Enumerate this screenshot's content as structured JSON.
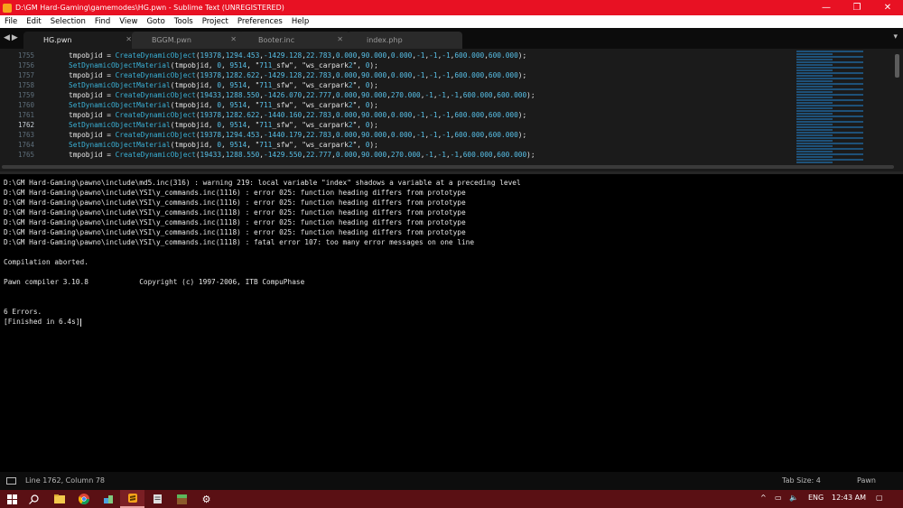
{
  "window": {
    "title": "D:\\GM Hard-Gaming\\gamemodes\\HG.pwn - Sublime Text (UNREGISTERED)",
    "minimize": "—",
    "maximize": "❐",
    "close": "✕"
  },
  "menu": [
    "File",
    "Edit",
    "Selection",
    "Find",
    "View",
    "Goto",
    "Tools",
    "Project",
    "Preferences",
    "Help"
  ],
  "tabs": [
    {
      "label": "HG.pwn",
      "active": true
    },
    {
      "label": "BGGM.pwn",
      "active": false
    },
    {
      "label": "Booter.inc",
      "active": false
    },
    {
      "label": "index.php",
      "active": false
    }
  ],
  "editor": {
    "line_numbers": [
      "1755",
      "1756",
      "1757",
      "1758",
      "1759",
      "1760",
      "1761",
      "1762",
      "1763",
      "1764",
      "1765"
    ],
    "current_line": "1762",
    "lines": [
      "tmpobjid = CreateDynamicObject(19378,1294.453,-1429.128,22.783,0.000,90.000,0.000,-1,-1,-1,600.000,600.000);",
      "SetDynamicObjectMaterial(tmpobjid, 0, 9514, \"711_sfw\", \"ws_carpark2\", 0);",
      "tmpobjid = CreateDynamicObject(19378,1282.622,-1429.128,22.783,0.000,90.000,0.000,-1,-1,-1,600.000,600.000);",
      "SetDynamicObjectMaterial(tmpobjid, 0, 9514, \"711_sfw\", \"ws_carpark2\", 0);",
      "tmpobjid = CreateDynamicObject(19433,1288.550,-1426.070,22.777,0.000,90.000,270.000,-1,-1,-1,600.000,600.000);",
      "SetDynamicObjectMaterial(tmpobjid, 0, 9514, \"711_sfw\", \"ws_carpark2\", 0);",
      "tmpobjid = CreateDynamicObject(19378,1282.622,-1440.160,22.783,0.000,90.000,0.000,-1,-1,-1,600.000,600.000);",
      "SetDynamicObjectMaterial(tmpobjid, 0, 9514, \"711_sfw\", \"ws_carpark2\", 0);",
      "tmpobjid = CreateDynamicObject(19378,1294.453,-1440.179,22.783,0.000,90.000,0.000,-1,-1,-1,600.000,600.000);",
      "SetDynamicObjectMaterial(tmpobjid, 0, 9514, \"711_sfw\", \"ws_carpark2\", 0);",
      "tmpobjid = CreateDynamicObject(19433,1288.550,-1429.550,22.777,0.000,90.000,270.000,-1,-1,-1,600.000,600.000);"
    ]
  },
  "output": {
    "lines": [
      "D:\\GM Hard-Gaming\\pawno\\include\\md5.inc(316) : warning 219: local variable \"index\" shadows a variable at a preceding level",
      "D:\\GM Hard-Gaming\\pawno\\include\\YSI\\y_commands.inc(1116) : error 025: function heading differs from prototype",
      "D:\\GM Hard-Gaming\\pawno\\include\\YSI\\y_commands.inc(1116) : error 025: function heading differs from prototype",
      "D:\\GM Hard-Gaming\\pawno\\include\\YSI\\y_commands.inc(1118) : error 025: function heading differs from prototype",
      "D:\\GM Hard-Gaming\\pawno\\include\\YSI\\y_commands.inc(1118) : error 025: function heading differs from prototype",
      "D:\\GM Hard-Gaming\\pawno\\include\\YSI\\y_commands.inc(1118) : error 025: function heading differs from prototype",
      "D:\\GM Hard-Gaming\\pawno\\include\\YSI\\y_commands.inc(1118) : fatal error 107: too many error messages on one line",
      "",
      "Compilation aborted.",
      "",
      "Pawn compiler 3.10.8            Copyright (c) 1997-2006, ITB CompuPhase",
      "",
      "",
      "6 Errors.",
      "[Finished in 6.4s]"
    ]
  },
  "statusbar": {
    "position": "Line 1762, Column 78",
    "tab_size": "Tab Size: 4",
    "syntax": "Pawn"
  },
  "taskbar": {
    "language": "ENG",
    "time": "12:43 AM",
    "tray_icons": [
      "chevron-up-icon",
      "network-icon",
      "volume-icon"
    ]
  },
  "colors": {
    "title_bar": "#e81123",
    "taskbar": "#5a1014",
    "function": "#3ab0d6"
  }
}
